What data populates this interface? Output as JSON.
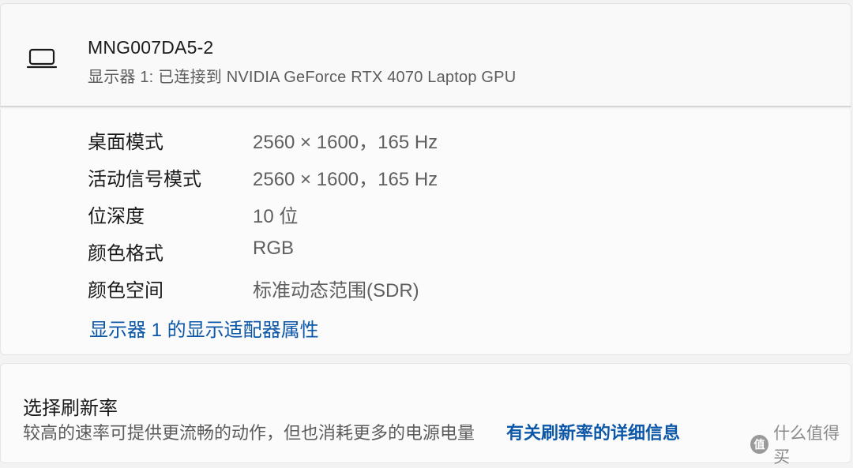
{
  "display": {
    "name": "MNG007DA5-2",
    "subtitle": "显示器 1: 已连接到 NVIDIA GeForce RTX 4070 Laptop GPU",
    "icon": "laptop-icon"
  },
  "details": [
    {
      "label": "桌面模式",
      "value": "2560 × 1600，165 Hz"
    },
    {
      "label": "活动信号模式",
      "value": "2560 × 1600，165 Hz"
    },
    {
      "label": "位深度",
      "value": "10 位"
    },
    {
      "label": "颜色格式",
      "value": "RGB"
    },
    {
      "label": "颜色空间",
      "value": "标准动态范围(SDR)"
    }
  ],
  "adapter_link": "显示器 1 的显示适配器属性",
  "refresh": {
    "title": "选择刷新率",
    "description": "较高的速率可提供更流畅的动作，但也消耗更多的电源电量",
    "link": "有关刷新率的详细信息"
  },
  "watermark": {
    "badge": "值",
    "text": "什么值得买"
  },
  "colors": {
    "link": "#0c57a8",
    "secondary_text": "#5c5c5c",
    "card_bg": "#fbfbfb"
  }
}
